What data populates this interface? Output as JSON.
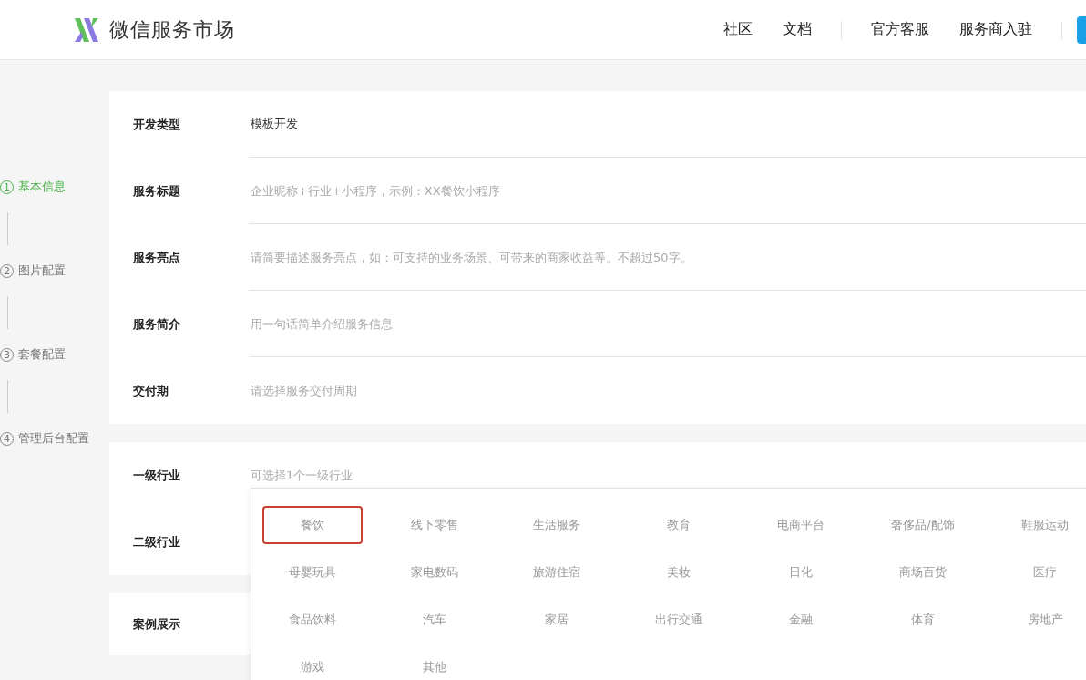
{
  "header": {
    "title": "微信服务市场",
    "nav_groups": [
      [
        "社区",
        "文档"
      ],
      [
        "官方客服",
        "服务商入驻"
      ]
    ]
  },
  "steps": [
    {
      "number": "1",
      "label": "基本信息",
      "selected": true
    },
    {
      "number": "2",
      "label": "图片配置",
      "selected": false
    },
    {
      "number": "3",
      "label": "套餐配置",
      "selected": false
    },
    {
      "number": "4",
      "label": "管理后台配置",
      "selected": false
    }
  ],
  "basic_form": [
    {
      "label": "开发类型",
      "value": "模板开发"
    },
    {
      "label": "服务标题",
      "placeholder": "企业昵称+行业+小程序，示例：XX餐饮小程序"
    },
    {
      "label": "服务亮点",
      "placeholder": "请简要描述服务亮点，如：可支持的业务场景、可带来的商家收益等。不超过50字。"
    },
    {
      "label": "服务简介",
      "placeholder": "用一句话简单介绍服务信息"
    },
    {
      "label": "交付期",
      "placeholder": "请选择服务交付周期"
    }
  ],
  "industry_form": [
    {
      "label": "一级行业",
      "placeholder": "可选择1个一级行业"
    },
    {
      "label": "二级行业"
    }
  ],
  "case_form": [
    {
      "label": "案例展示"
    }
  ],
  "industry_dropdown": {
    "options": [
      {
        "label": "餐饮",
        "selected": true
      },
      {
        "label": "线下零售",
        "selected": false
      },
      {
        "label": "生活服务",
        "selected": false
      },
      {
        "label": "教育",
        "selected": false
      },
      {
        "label": "电商平台",
        "selected": false
      },
      {
        "label": "奢侈品/配饰",
        "selected": false
      },
      {
        "label": "鞋服运动",
        "selected": false
      },
      {
        "label": "母婴玩具",
        "selected": false
      },
      {
        "label": "家电数码",
        "selected": false
      },
      {
        "label": "旅游住宿",
        "selected": false
      },
      {
        "label": "美妆",
        "selected": false
      },
      {
        "label": "日化",
        "selected": false
      },
      {
        "label": "商场百货",
        "selected": false
      },
      {
        "label": "医疗",
        "selected": false
      },
      {
        "label": "食品饮料",
        "selected": false
      },
      {
        "label": "汽车",
        "selected": false
      },
      {
        "label": "家居",
        "selected": false
      },
      {
        "label": "出行交通",
        "selected": false
      },
      {
        "label": "金融",
        "selected": false
      },
      {
        "label": "体育",
        "selected": false
      },
      {
        "label": "房地产",
        "selected": false
      },
      {
        "label": "游戏",
        "selected": false
      },
      {
        "label": "其他",
        "selected": false
      }
    ]
  }
}
